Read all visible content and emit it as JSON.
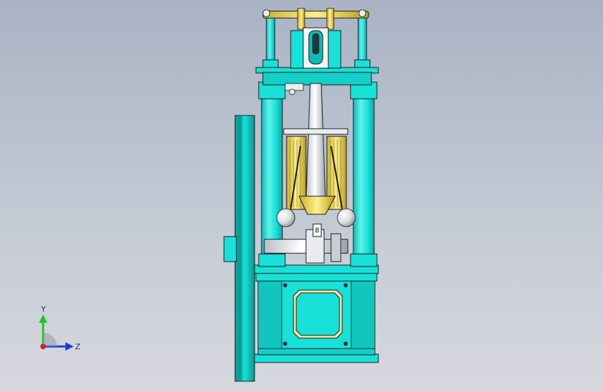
{
  "viewport": {
    "background_top": "#a9b3c4",
    "background_bottom": "#d6d8de"
  },
  "model": {
    "description_name": "vertical-steam-engine-assembly",
    "colors": {
      "body": "#19e0d8",
      "body_shade": "#0fbab4",
      "outline": "#1a1a1a",
      "brass": "#e8d24a",
      "steel": "#e8ecef",
      "steel_shade": "#9aa3aa"
    }
  },
  "triad": {
    "y_label": "Y",
    "z_label": "Z",
    "y_color": "#22c02a",
    "z_color": "#1a3fd8",
    "origin_color": "#d82020"
  }
}
